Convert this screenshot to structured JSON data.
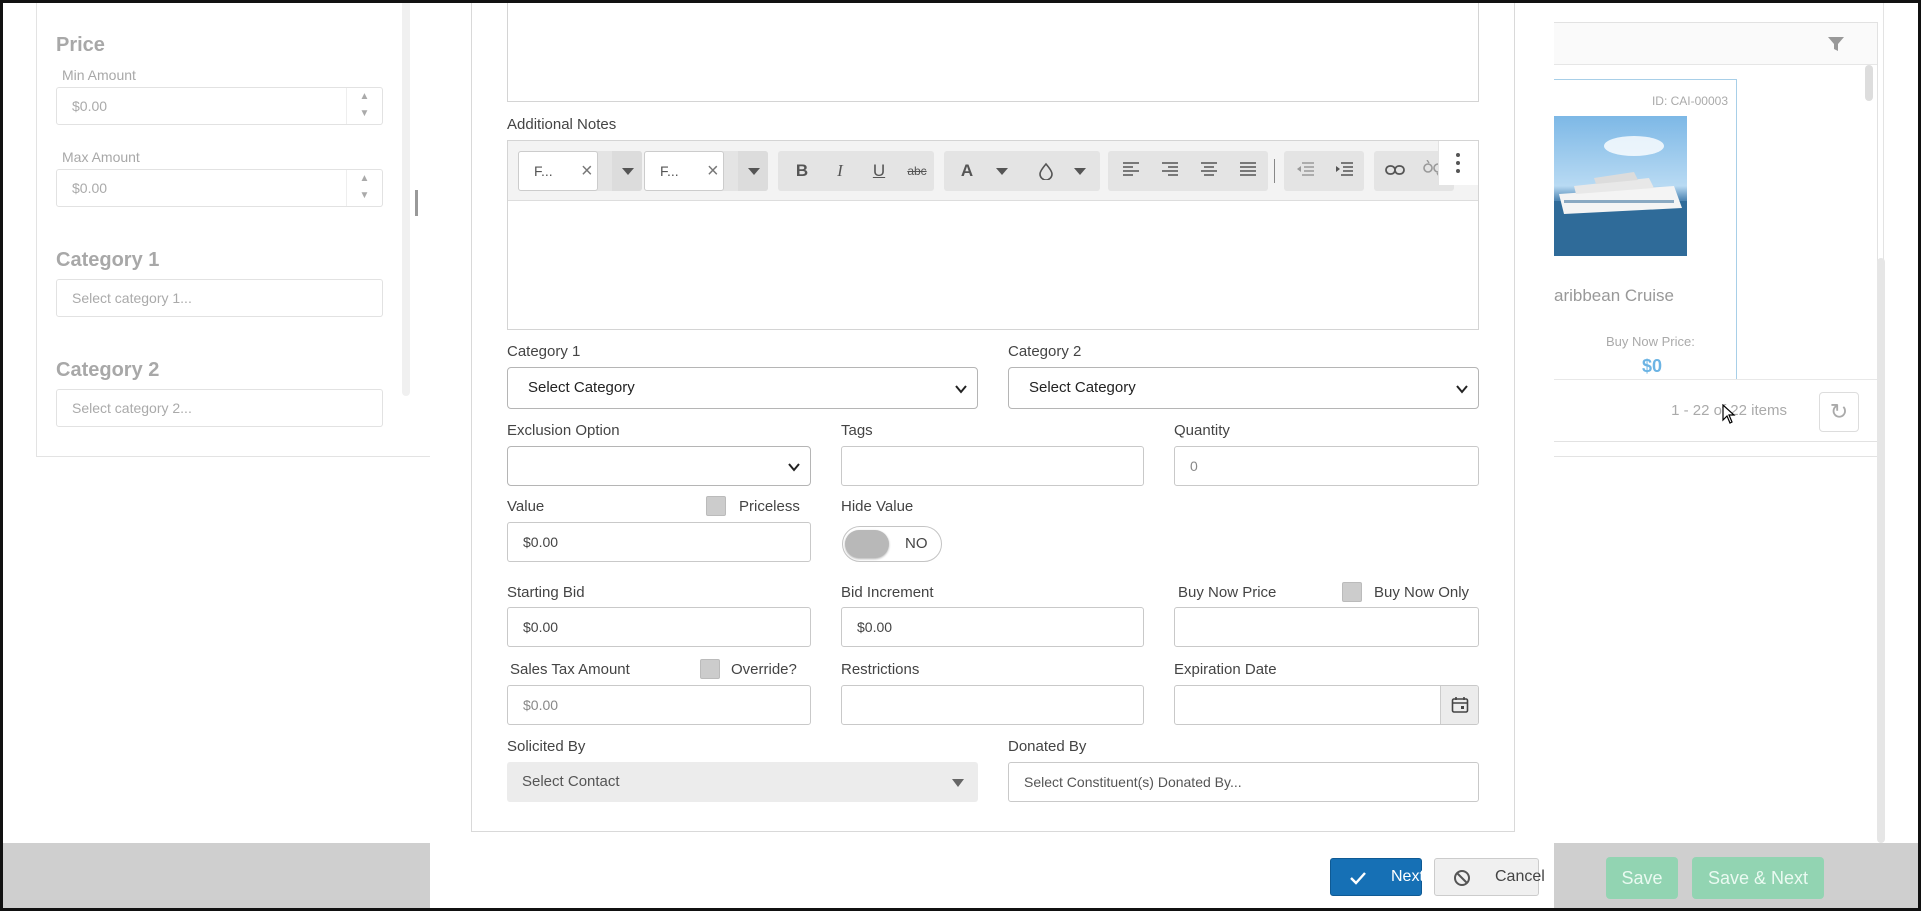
{
  "background": {
    "filters": {
      "price_heading": "Price",
      "min_amount_label": "Min Amount",
      "min_amount_value": "$0.00",
      "max_amount_label": "Max Amount",
      "max_amount_value": "$0.00",
      "category1_heading": "Category 1",
      "category1_placeholder": "Select category 1...",
      "category2_heading": "Category 2",
      "category2_placeholder": "Select category 2..."
    },
    "grid": {
      "item_id": "ID: CAI-00003",
      "item_name": "aribbean Cruise",
      "buy_now_label": "Buy Now Price:",
      "buy_now_value": "$0",
      "pager_text": "1 - 22 of 22 items"
    },
    "save_label": "Save",
    "save_next_label": "Save & Next"
  },
  "form": {
    "additional_notes_label": "Additional Notes",
    "toolbar": {
      "font_family": "F...",
      "font_size": "F..."
    },
    "category1_label": "Category 1",
    "category1_value": "Select Category",
    "category2_label": "Category 2",
    "category2_value": "Select Category",
    "exclusion_label": "Exclusion Option",
    "exclusion_value": "",
    "tags_label": "Tags",
    "tags_value": "",
    "quantity_label": "Quantity",
    "quantity_placeholder": "0",
    "value_label": "Value",
    "priceless_label": "Priceless",
    "value_value": "$0.00",
    "hide_value_label": "Hide Value",
    "hide_value_state": "NO",
    "starting_bid_label": "Starting Bid",
    "starting_bid_value": "$0.00",
    "bid_increment_label": "Bid Increment",
    "bid_increment_value": "$0.00",
    "buy_now_price_label": "Buy Now Price",
    "buy_now_only_label": "Buy Now Only",
    "buy_now_price_value": "",
    "sales_tax_label": "Sales Tax Amount",
    "override_label": "Override?",
    "sales_tax_value": "$0.00",
    "restrictions_label": "Restrictions",
    "restrictions_value": "",
    "expiration_label": "Expiration Date",
    "expiration_value": "",
    "solicited_by_label": "Solicited By",
    "solicited_by_value": "Select Contact",
    "donated_by_label": "Donated By",
    "donated_by_placeholder": "Select Constituent(s) Donated By..."
  },
  "actions": {
    "next_label": "Next",
    "cancel_label": "Cancel"
  },
  "colors": {
    "primary": "#1670b5",
    "disabled_green": "#92d4b2"
  }
}
